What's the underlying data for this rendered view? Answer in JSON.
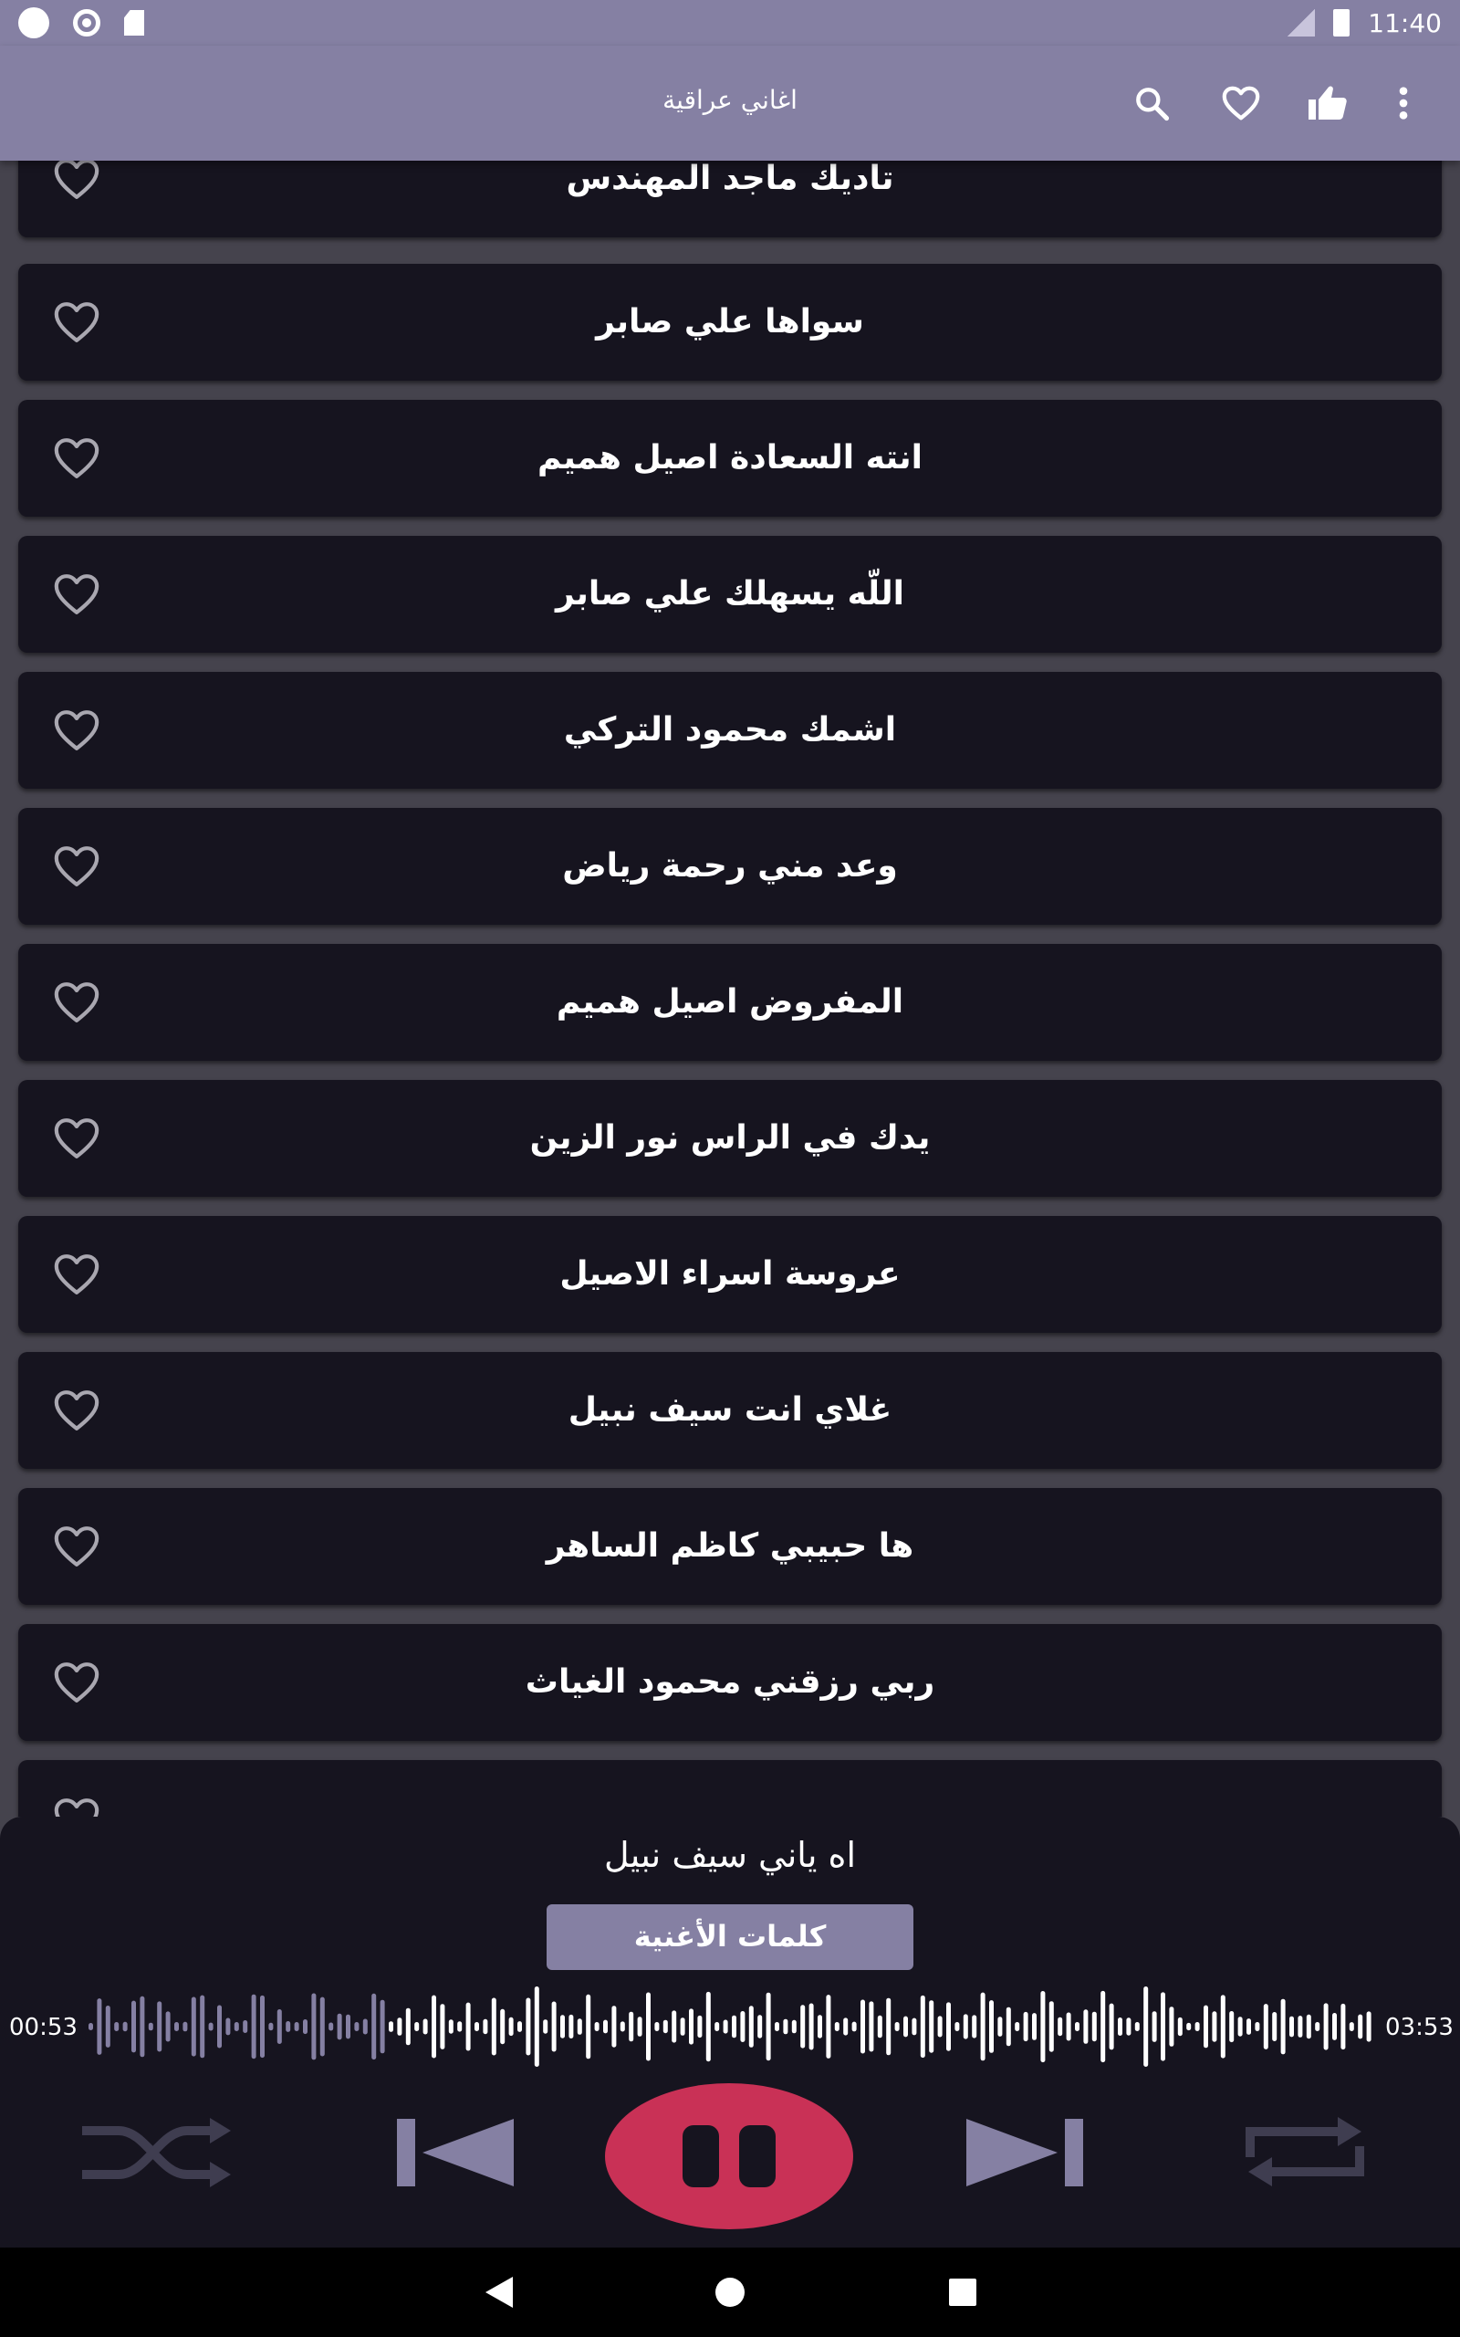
{
  "status_bar": {
    "time": "11:40"
  },
  "app_bar": {
    "title": "اغاني عراقية",
    "icons": [
      "search-icon",
      "heart-icon",
      "thumbs-up-icon",
      "more-vert-icon"
    ]
  },
  "songs": [
    {
      "title": "تاديك ماجد المهندس"
    },
    {
      "title": "سواها علي صابر"
    },
    {
      "title": "انته السعادة اصيل هميم"
    },
    {
      "title": "اللّه يسهلك علي صابر"
    },
    {
      "title": "اشمك محمود التركي"
    },
    {
      "title": "وعد مني رحمة رياض"
    },
    {
      "title": "المفروض اصيل هميم"
    },
    {
      "title": "يدك في الراس نور الزين"
    },
    {
      "title": "عروسة اسراء الاصيل"
    },
    {
      "title": "غلاي انت سيف نبيل"
    },
    {
      "title": "ها حبيبي كاظم الساهر"
    },
    {
      "title": "ربي رزقني محمود الغياث"
    },
    {
      "title": ""
    }
  ],
  "player": {
    "now_playing": "اه ياني سيف نبيل",
    "lyrics_label": "كلمات الأغنية",
    "elapsed": "00:53",
    "duration": "03:53",
    "progress": 0.2275,
    "state": "playing"
  },
  "colors": {
    "accent": "#8580a3",
    "play_button": "#c93156",
    "card_bg": "#16141f",
    "page_bg": "#45434d"
  }
}
